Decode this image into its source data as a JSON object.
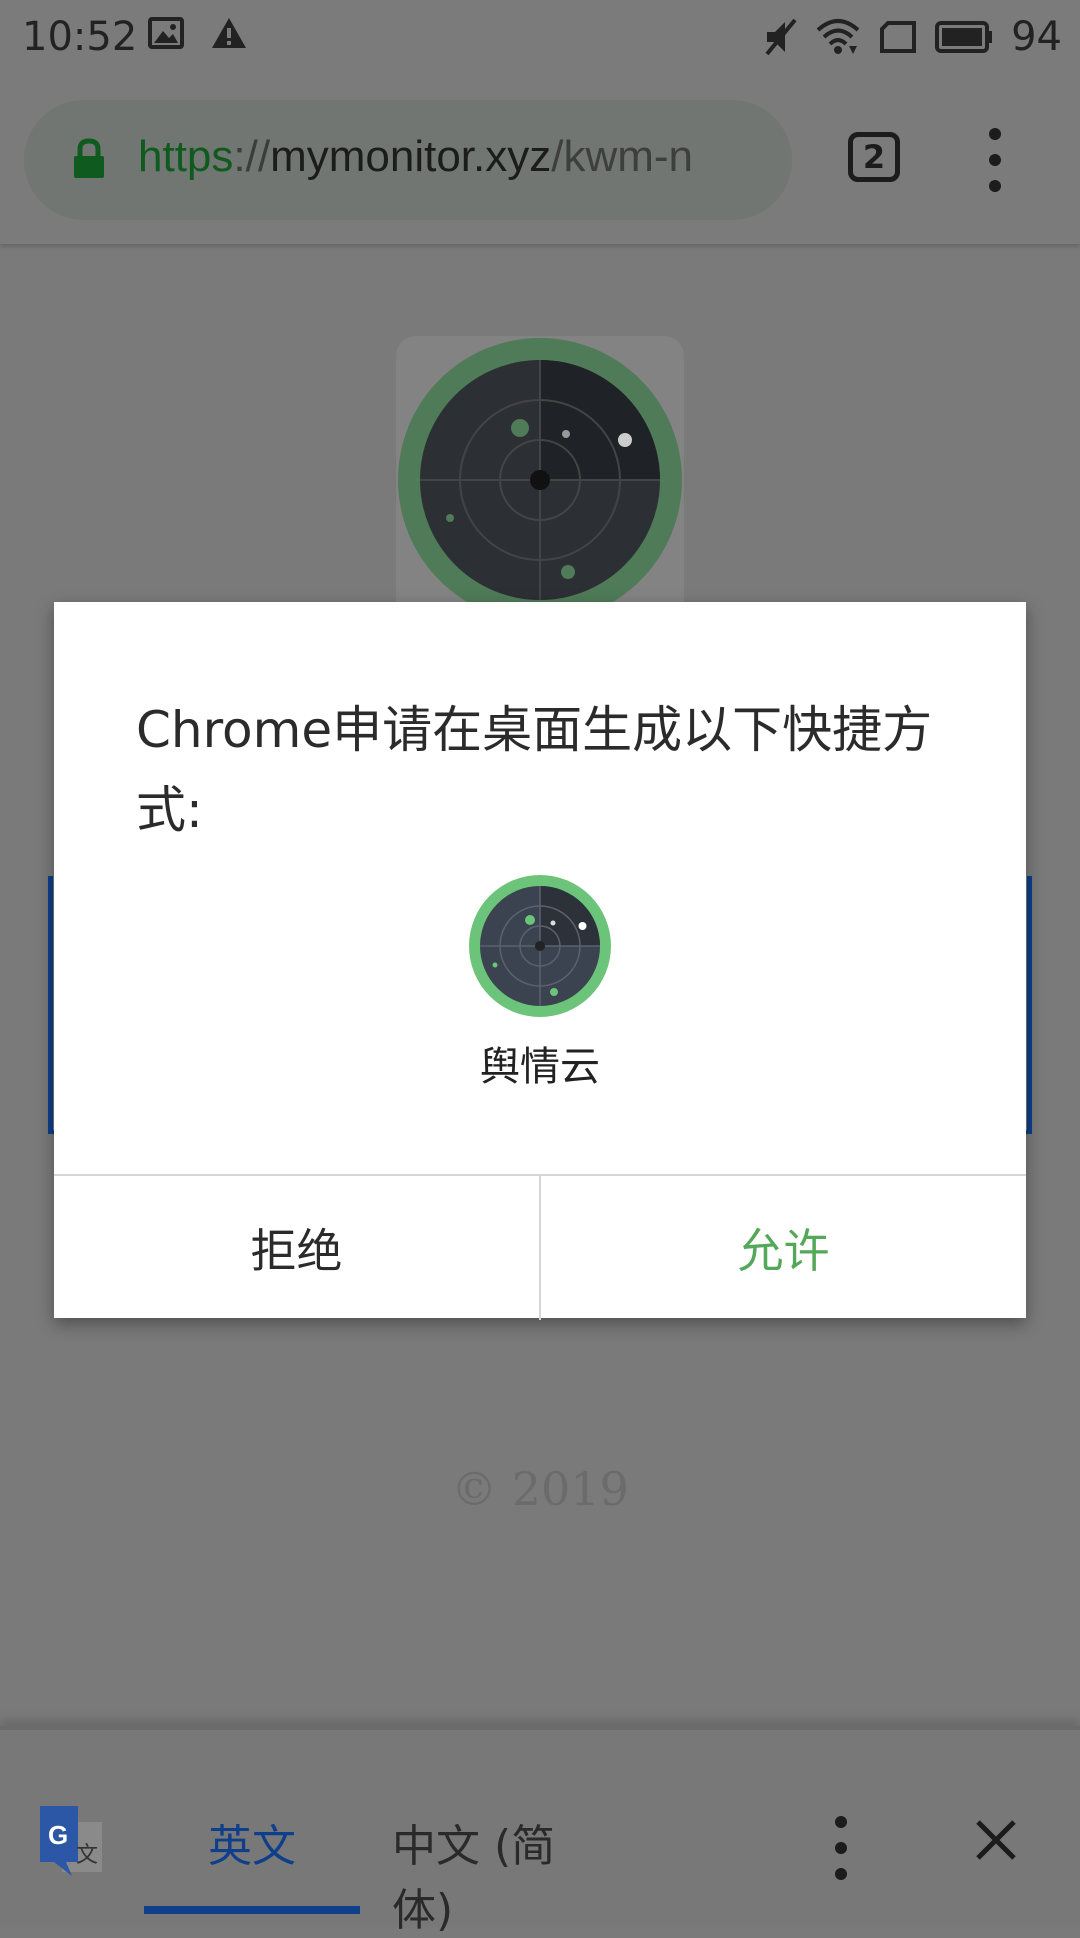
{
  "status_bar": {
    "time": "10:52",
    "left_icons": [
      "image-icon",
      "warning-icon"
    ],
    "right_icons": [
      "vibrate-off-icon",
      "wifi-icon",
      "sim-icon",
      "battery-icon"
    ],
    "battery_level": "94"
  },
  "toolbar": {
    "url_scheme": "https",
    "url_sep": "://",
    "url_host": "mymonitor.xyz",
    "url_path": "/kwm-n",
    "tab_count": "2"
  },
  "page": {
    "copyright": "© 2019"
  },
  "dialog": {
    "message": "Chrome申请在桌面生成以下快捷方式:",
    "app_name": "舆情云",
    "deny_label": "拒绝",
    "allow_label": "允许"
  },
  "translate_bar": {
    "source_lang": "英文",
    "target_lang": "中文 (简体)"
  },
  "colors": {
    "accent_green": "#54a859",
    "tab_blue": "#0f3f8a",
    "scrim": "#7a7a7a"
  }
}
